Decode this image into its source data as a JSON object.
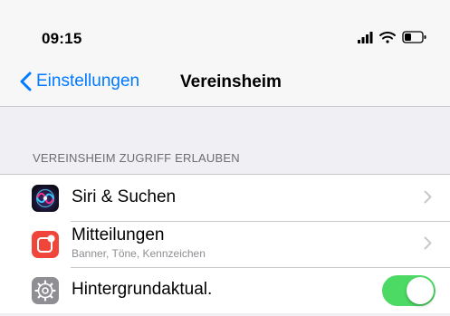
{
  "status_bar": {
    "time": "09:15",
    "icons": [
      "signal-icon",
      "wifi-icon",
      "battery-icon"
    ]
  },
  "nav": {
    "back_label": "Einstellungen",
    "title": "Vereinsheim"
  },
  "section": {
    "header": "VEREINSHEIM ZUGRIFF ERLAUBEN"
  },
  "rows": [
    {
      "title": "Siri & Suchen",
      "icon": "siri-icon",
      "accessory": "chevron"
    },
    {
      "title": "Mitteilungen",
      "subtitle": "Banner, Töne, Kennzeichen",
      "icon": "notifications-icon",
      "icon_color": "#f0453a",
      "accessory": "chevron"
    },
    {
      "title": "Hintergrundaktual.",
      "icon": "gear-icon",
      "icon_color": "#8e8e93",
      "accessory": "toggle",
      "toggle_on": true
    }
  ],
  "colors": {
    "accent": "#007aff",
    "toggle_on": "#4cd964",
    "background": "#efeff4"
  }
}
